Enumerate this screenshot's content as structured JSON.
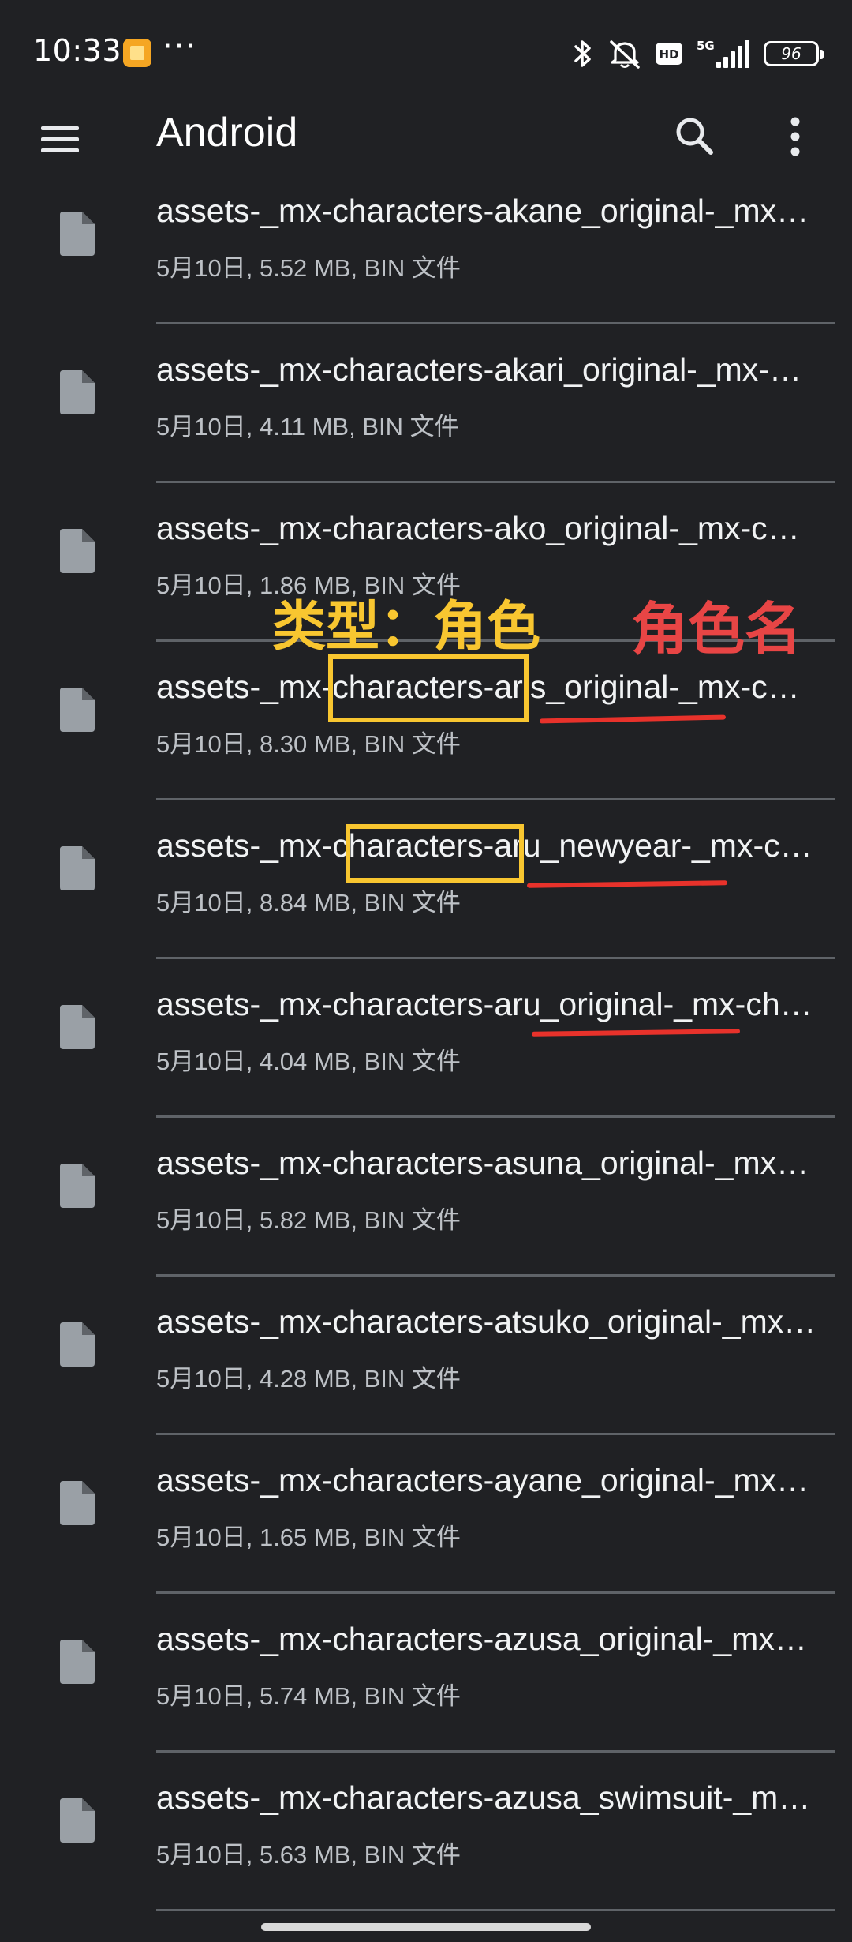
{
  "status_bar": {
    "time": "10:33",
    "more": "···",
    "battery": "96",
    "icons": [
      "notification-app-icon",
      "bluetooth-icon",
      "mute-icon",
      "hd-icon",
      "5g-signal-icon",
      "battery-icon"
    ]
  },
  "app_bar": {
    "title": "Android",
    "icons": [
      "menu-icon",
      "search-icon",
      "more-vert-icon"
    ]
  },
  "files": [
    {
      "name": "assets-_mx-characters-akane_original-_mx-characters-akane",
      "meta": "5月10日, 5.52 MB, BIN 文件"
    },
    {
      "name": "assets-_mx-characters-akari_original-_mx-characters-akari",
      "meta": "5月10日, 4.11 MB, BIN 文件"
    },
    {
      "name": "assets-_mx-characters-ako_original-_mx-characters-ako",
      "meta": "5月10日, 1.86 MB, BIN 文件"
    },
    {
      "name": "assets-_mx-characters-aris_original-_mx-characters-aris",
      "meta": "5月10日, 8.30 MB, BIN 文件"
    },
    {
      "name": "assets-_mx-characters-aru_newyear-_mx-characters-aru",
      "meta": "5月10日, 8.84 MB, BIN 文件"
    },
    {
      "name": "assets-_mx-characters-aru_original-_mx-characters-aru",
      "meta": "5月10日, 4.04 MB, BIN 文件"
    },
    {
      "name": "assets-_mx-characters-asuna_original-_mx-characters-asuna",
      "meta": "5月10日, 5.82 MB, BIN 文件"
    },
    {
      "name": "assets-_mx-characters-atsuko_original-_mx-characters-atsuko",
      "meta": "5月10日, 4.28 MB, BIN 文件"
    },
    {
      "name": "assets-_mx-characters-ayane_original-_mx-characters-ayane",
      "meta": "5月10日, 1.65 MB, BIN 文件"
    },
    {
      "name": "assets-_mx-characters-azusa_original-_mx-characters-azusa",
      "meta": "5月10日, 5.74 MB, BIN 文件"
    },
    {
      "name": "assets-_mx-characters-azusa_swimsuit-_mx-characters-azusa",
      "meta": "5月10日, 5.63 MB, BIN 文件"
    }
  ],
  "annotations": {
    "type_label": "类型：角色",
    "name_label": "角色名",
    "box_color": "#f8c630",
    "underline_color": "#e8322b"
  },
  "colors": {
    "background": "#202124",
    "divider": "#5f6368",
    "primary_text": "#f1f3f4",
    "secondary_text": "#bdc1c6"
  }
}
